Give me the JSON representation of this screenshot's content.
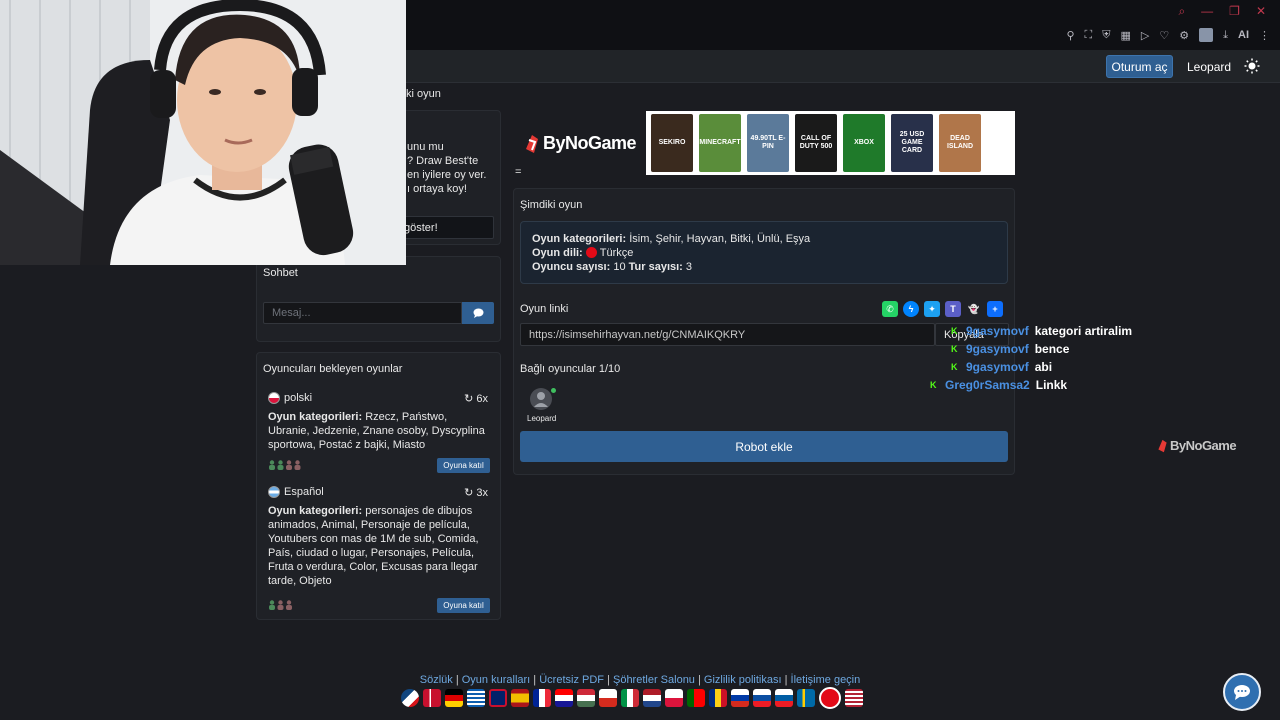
{
  "browser": {
    "ext_ai_label": "AI"
  },
  "navbar": {
    "login_label": "Oturum aç",
    "user_label": "Leopard"
  },
  "left": {
    "partial_title": "ki oyun",
    "draw_text": "unu mu\n? Draw Best'te\nen iyilere oy ver.\nı ortaya koy!",
    "draw_button": "göster!",
    "chat": {
      "title": "Sohbet",
      "placeholder": "Mesaj..."
    },
    "waiting": {
      "title": "Oyuncuları bekleyen oyunlar",
      "games": [
        {
          "lang": "polski",
          "count": "6x",
          "cats_label": "Oyun kategorileri:",
          "cats": "Rzecz, Państwo, Ubranie, Jedzenie, Znane osoby, Dyscyplina sportowa, Postać z bajki, Miasto",
          "join": "Oyuna katıl"
        },
        {
          "lang": "Español",
          "count": "3x",
          "cats_label": "Oyun kategorileri:",
          "cats": "personajes de dibujos animados, Animal, Personaje de película, Youtubers con mas de 1M de sub, Comida, País, ciudad o lugar, Personajes, Película, Fruta o verdura, Color, Excusas para llegar tarde, Objeto",
          "join": "Oyuna katıl"
        }
      ]
    }
  },
  "ad": {
    "logo": "ByNoGame",
    "eq": "=",
    "cards": [
      {
        "label": "SEKIRO",
        "color": "#3a2a1e"
      },
      {
        "label": "MINECRAFT",
        "color": "#5a8d3a"
      },
      {
        "label": "49.90TL E-PIN",
        "color": "#5b7a9a"
      },
      {
        "label": "CALL OF DUTY 500",
        "color": "#1a1a1a"
      },
      {
        "label": "XBOX",
        "color": "#1f7a2a"
      },
      {
        "label": "25 USD GAME CARD",
        "color": "#28304a"
      },
      {
        "label": "DEAD ISLAND",
        "color": "#b0764a"
      }
    ]
  },
  "main": {
    "title": "Şimdiki oyun",
    "info": {
      "cats_label": "Oyun kategorileri:",
      "cats": "İsim, Şehir, Hayvan, Bitki, Ünlü, Eşya",
      "lang_label": "Oyun dili:",
      "lang": "Türkçe",
      "players_label": "Oyuncu sayısı:",
      "players": "10",
      "rounds_label": "Tur sayısı:",
      "rounds": "3"
    },
    "link_label": "Oyun linki",
    "link_value": "https://isimsehirhayvan.net/g/CNMAIKQKRY",
    "copy_label": "Kopyala",
    "players_title": "Bağlı oyuncular 1/10",
    "player_name": "Leopard",
    "robot_button": "Robot ekle"
  },
  "stream_chat": [
    {
      "user": "9gasymovf",
      "msg": "kategori artiralim"
    },
    {
      "user": "9gasymovf",
      "msg": "bence"
    },
    {
      "user": "9gasymovf",
      "msg": "abi"
    },
    {
      "user": "Greg0rSamsa2",
      "msg": "Linkk"
    }
  ],
  "watermark": "ByNoGame",
  "footer": {
    "links": [
      "Sözlük",
      "Oyun kuralları",
      "Ücretsiz PDF",
      "Şöhretler Salonu",
      "Gizlilik politikası",
      "İletişime geçin"
    ]
  },
  "colors": {
    "accent": "#2f5f92",
    "panel": "#1f2126",
    "link": "#6ea8e0"
  }
}
